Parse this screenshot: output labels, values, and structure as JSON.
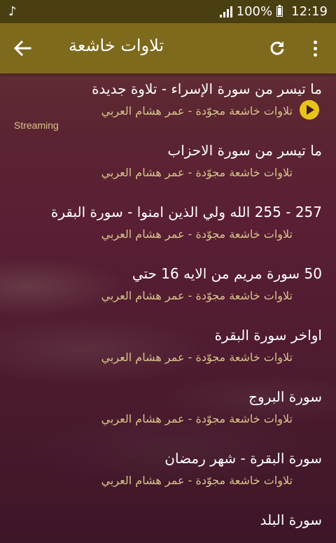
{
  "status_bar": {
    "music_icon": "music-note-icon",
    "battery_percent": "100%",
    "time": "12:19"
  },
  "app_bar": {
    "title": "تلاوات خاشعة",
    "back_icon": "back-arrow-icon",
    "refresh_icon": "refresh-icon",
    "menu_icon": "more-vert-icon"
  },
  "playing_item": {
    "play_icon": "play-circle-icon",
    "streaming_label": "Streaming"
  },
  "tracks": [
    {
      "title": "ما تيسر من سورة الإسراء - تلاوة جديدة",
      "subtitle": "تلاوات خاشعة مجوّدة - عمر هشام العربي"
    },
    {
      "title": "ما تيسر من سورة الاحزاب",
      "subtitle": "تلاوات خاشعة مجوّدة - عمر هشام العربي"
    },
    {
      "title": "257 - 255 الله ولي الذين امنوا - سورة البقرة",
      "subtitle": "تلاوات خاشعة مجوّدة - عمر هشام العربي"
    },
    {
      "title": "50 سورة مريم من الايه 16 حتي",
      "subtitle": "تلاوات خاشعة مجوّدة - عمر هشام العربي"
    },
    {
      "title": "اواخر سورة البقرة",
      "subtitle": "تلاوات خاشعة مجوّدة - عمر هشام العربي"
    },
    {
      "title": "سورة البروج",
      "subtitle": "تلاوات خاشعة مجوّدة - عمر هشام العربي"
    },
    {
      "title": "سورة البقرة - شهر رمضان",
      "subtitle": "تلاوات خاشعة مجوّدة - عمر هشام العربي"
    },
    {
      "title": "سورة البلد",
      "subtitle": ""
    }
  ],
  "colors": {
    "status_bar": "#4a3f10",
    "app_bar": "#7e6a1c",
    "accent": "#e8c31a",
    "subtitle": "#d8c48a"
  }
}
